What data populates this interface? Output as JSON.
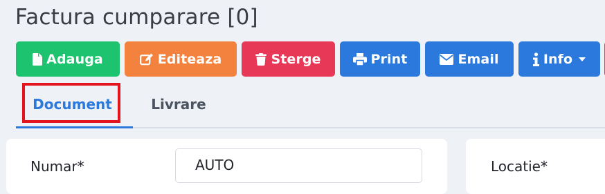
{
  "page": {
    "title": "Factura cumparare [0]"
  },
  "toolbar": {
    "add_label": "Adauga",
    "edit_label": "Editeaza",
    "delete_label": "Sterge",
    "print_label": "Print",
    "email_label": "Email",
    "info_label": "Info",
    "colors": {
      "add": "#1ec36f",
      "edit": "#f3823e",
      "delete": "#e83857",
      "primary": "#2c79dd"
    }
  },
  "tabs": [
    {
      "label": "Document",
      "active": true
    },
    {
      "label": "Livrare",
      "active": false
    }
  ],
  "form": {
    "numar_label": "Numar*",
    "numar_value": "AUTO",
    "locatie_label": "Locatie*"
  }
}
